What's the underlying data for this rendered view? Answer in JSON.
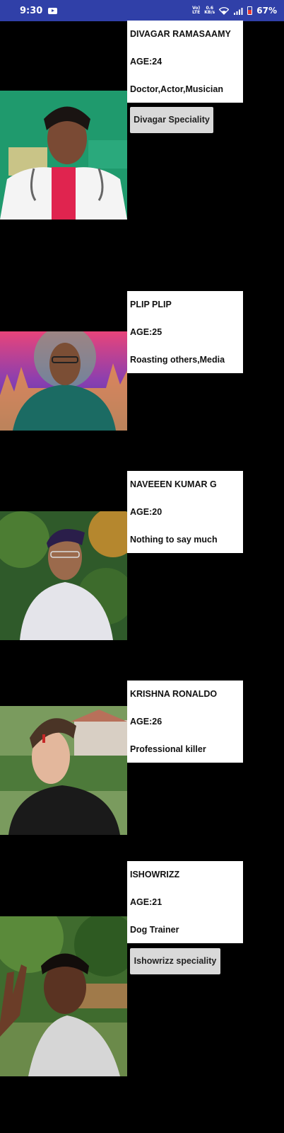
{
  "status_bar": {
    "time": "9:30",
    "network_top": "Vo)",
    "network_bottom": "LTE",
    "speed_top": "0.6",
    "speed_bottom": "KB/s",
    "battery": "67%"
  },
  "profiles": [
    {
      "name": "DIVAGAR RAMASAAMY",
      "age": "AGE:24",
      "specialty": "Doctor,Actor,Musician",
      "button": "Divagar Speciality",
      "photo": "doctor-portrait"
    },
    {
      "name": "PLIP PLIP",
      "age": "AGE:25",
      "specialty": "Roasting others,Media",
      "photo": "bald-man-portrait"
    },
    {
      "name": "NAVEEEN KUMAR G",
      "age": "AGE:20",
      "specialty": "Nothing to say much",
      "photo": "hoodie-portrait"
    },
    {
      "name": "KRISHNA RONALDO",
      "age": "AGE:26",
      "specialty": "Professional killer",
      "photo": "black-shirt-portrait"
    },
    {
      "name": "ISHOWRIZZ",
      "age": "AGE:21",
      "specialty": "Dog Trainer",
      "button": "Ishowrizz speciality",
      "photo": "peace-sign-portrait"
    }
  ]
}
